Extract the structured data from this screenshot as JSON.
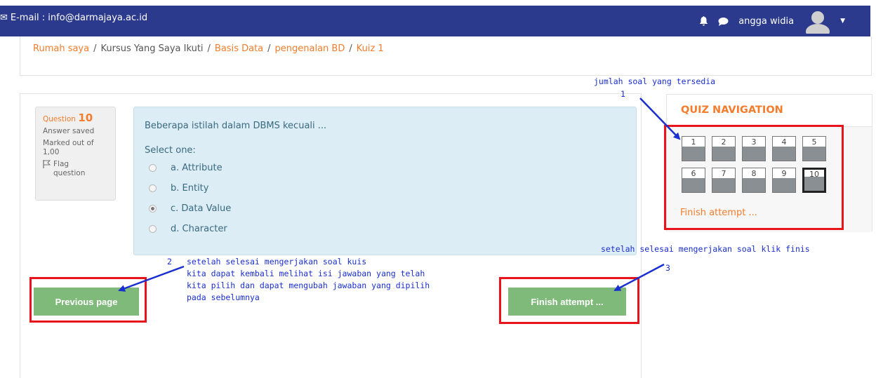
{
  "navbar": {
    "email": "E-mail : info@darmajaya.ac.id",
    "user_name": "angga widia"
  },
  "breadcrumb": {
    "items": [
      "Rumah saya",
      "Kursus Yang Saya Ikuti",
      "Basis Data",
      "pengenalan BD",
      "Kuiz 1"
    ],
    "separator": "/"
  },
  "question_info": {
    "label": "Question",
    "number": "10",
    "status": "Answer saved",
    "marked_out_of": "Marked out of 1,00",
    "flag_label": "Flag question"
  },
  "question": {
    "text": "Beberapa istilah dalam DBMS kecuali ...",
    "select_prompt": "Select one:",
    "options": [
      "a. Attribute",
      "b. Entity",
      "c. Data Value",
      "d. Character"
    ],
    "selected_index": 2
  },
  "buttons": {
    "previous": "Previous page",
    "finish": "Finish attempt ..."
  },
  "quiz_nav": {
    "title": "QUIZ NAVIGATION",
    "questions": [
      "1",
      "2",
      "3",
      "4",
      "5",
      "6",
      "7",
      "8",
      "9",
      "10"
    ],
    "current": "10",
    "finish_link": "Finish attempt ..."
  },
  "annotations": {
    "a1_line1": "jumlah soal yang tersedia",
    "a1_num": "1",
    "a2_num": "2",
    "a2_line1": "setelah selesai mengerjakan soal kuis",
    "a2_line2": "kita dapat kembali melihat isi jawaban yang telah",
    "a2_line3": "kita pilih dan dapat mengubah jawaban yang dipilih",
    "a2_line4": "pada sebelumnya",
    "a3_line1": "setelah selesai mengerjakan soal klik finis",
    "a3_num": "3"
  },
  "colors": {
    "navbar": "#2b3a8c",
    "accent_orange": "#f47c2b",
    "button_green": "#7fba7a",
    "annotation_blue": "#1a2fd0",
    "highlight_red": "#e8141c"
  }
}
